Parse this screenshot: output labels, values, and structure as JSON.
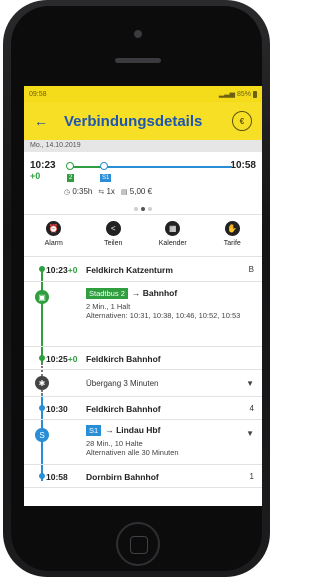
{
  "status": {
    "time": "09:58",
    "battery": "85%"
  },
  "header": {
    "back_icon": "back-arrow-icon",
    "title": "Verbindungsdetails",
    "tariff_icon": "tariff-icon"
  },
  "date": "Mo., 14.10.2019",
  "summary": {
    "departure_time": "10:23",
    "delay": "+0",
    "arrival_time": "10:58",
    "line1": "2",
    "line2": "S1",
    "duration": "0:35h",
    "transfers": "1x",
    "price": "5,00 €",
    "page_index": 2,
    "page_count": 3
  },
  "actions": [
    {
      "label": "Alarm",
      "icon": "alarm-clock-icon"
    },
    {
      "label": "Teilen",
      "icon": "share-icon"
    },
    {
      "label": "Kalender",
      "icon": "calendar-icon"
    },
    {
      "label": "Tarife",
      "icon": "tariff-hand-icon"
    }
  ],
  "journey": {
    "stop1": {
      "time": "10:23",
      "delay": "+0",
      "name": "Feldkirch Katzenturm",
      "platform": "B"
    },
    "seg1": {
      "line": "Stadtbus 2",
      "direction": "Bahnhof",
      "detail": "2 Min., 1 Halt",
      "alternatives": "Alternativen: 10:31, 10:38, 10:46, 10:52, 10:53"
    },
    "stop2": {
      "time": "10:25",
      "delay": "+0",
      "name": "Feldkirch Bahnhof",
      "platform": ""
    },
    "transfer": {
      "text": "Übergang 3 Minuten"
    },
    "stop3": {
      "time": "10:30",
      "name": "Feldkirch Bahnhof",
      "platform": "4"
    },
    "seg2": {
      "line": "S1",
      "direction": "Lindau Hbf",
      "detail": "28 Min., 10 Halte",
      "alternatives": "Alternativen alle 30 Minuten"
    },
    "stop4": {
      "time": "10:58",
      "name": "Dornbirn Bahnhof",
      "platform": "1"
    }
  },
  "colors": {
    "header": "#f7df25",
    "title": "#1e56b3",
    "bus": "#2e9e3e",
    "train": "#2a8ed6"
  }
}
